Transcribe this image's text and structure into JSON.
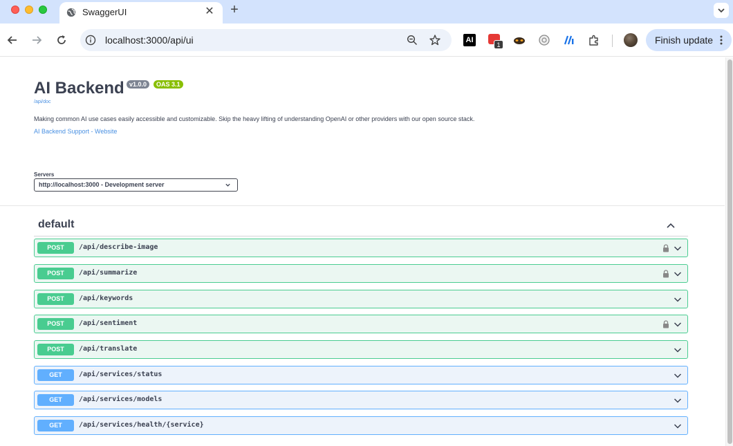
{
  "browser": {
    "tab_title": "SwaggerUI",
    "tab_close": "✕",
    "new_tab": "+",
    "url": "localhost:3000/api/ui",
    "ext_ai_label": "AI",
    "ext_badge_count": "1",
    "finish_update": "Finish update"
  },
  "info": {
    "title": "AI Backend",
    "version": "v1.0.0",
    "oas": "OAS 3.1",
    "spec_link": "/api/doc",
    "description": "Making common AI use cases easily accessible and customizable. Skip the heavy lifting of understanding OpenAI or other providers with our open source stack.",
    "support_link": "AI Backend Support - Website"
  },
  "servers": {
    "label": "Servers",
    "selected": "http://localhost:3000 - Development server"
  },
  "tag": {
    "name": "default"
  },
  "operations": [
    {
      "method": "POST",
      "path": "/api/describe-image",
      "locked": true
    },
    {
      "method": "POST",
      "path": "/api/summarize",
      "locked": true
    },
    {
      "method": "POST",
      "path": "/api/keywords",
      "locked": false
    },
    {
      "method": "POST",
      "path": "/api/sentiment",
      "locked": true
    },
    {
      "method": "POST",
      "path": "/api/translate",
      "locked": false
    },
    {
      "method": "GET",
      "path": "/api/services/status",
      "locked": false
    },
    {
      "method": "GET",
      "path": "/api/services/models",
      "locked": false
    },
    {
      "method": "GET",
      "path": "/api/services/health/{service}",
      "locked": false
    }
  ],
  "colors": {
    "post": "#49cc90",
    "get": "#61affe",
    "text": "#3b4151",
    "link": "#4990e2"
  }
}
